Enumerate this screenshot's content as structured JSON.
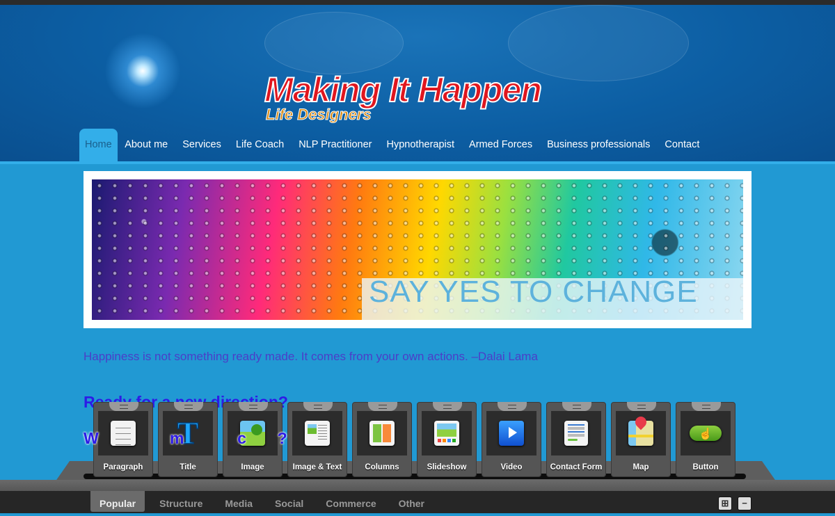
{
  "logo": {
    "main": "Making It Happen",
    "sub": "Life Designers"
  },
  "nav": [
    "Home",
    "About me",
    "Services",
    "Life Coach",
    "NLP Practitioner",
    "Hypnotherapist",
    "Armed Forces",
    "Business professionals",
    "Contact"
  ],
  "banner": {
    "caption": "SAY YES TO CHANGE"
  },
  "content": {
    "quote": "Happiness is not something ready made.  It comes from your own actions. –Dalai Lama",
    "heading1": "Ready for a new direction?",
    "heading2": "W                m            c       ?"
  },
  "widgets": [
    {
      "label": "Paragraph",
      "icon": "paragraph-icon"
    },
    {
      "label": "Title",
      "icon": "title-icon"
    },
    {
      "label": "Image",
      "icon": "image-icon"
    },
    {
      "label": "Image & Text",
      "icon": "image-text-icon"
    },
    {
      "label": "Columns",
      "icon": "columns-icon"
    },
    {
      "label": "Slideshow",
      "icon": "slideshow-icon"
    },
    {
      "label": "Video",
      "icon": "video-icon"
    },
    {
      "label": "Contact Form",
      "icon": "contact-form-icon"
    },
    {
      "label": "Map",
      "icon": "map-icon"
    },
    {
      "label": "Button",
      "icon": "button-icon"
    }
  ],
  "title_glyph": "T",
  "categories": [
    "Popular",
    "Structure",
    "Media",
    "Social",
    "Commerce",
    "Other"
  ],
  "toolbar": {
    "grid_icon": "⊞",
    "minimize_icon": "−"
  }
}
